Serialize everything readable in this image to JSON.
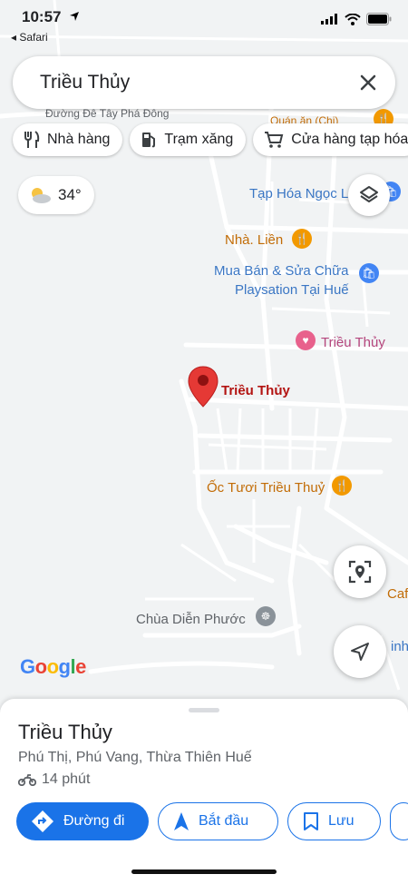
{
  "status_bar": {
    "time": "10:57",
    "back_app": "◂ Safari"
  },
  "search": {
    "query": "Triều Thủy"
  },
  "chips": [
    {
      "icon": "fork-knife-icon",
      "label": "Nhà hàng"
    },
    {
      "icon": "gas-pump-icon",
      "label": "Trạm xăng"
    },
    {
      "icon": "cart-icon",
      "label": "Cửa hàng tạp hóa"
    }
  ],
  "weather": {
    "temp": "34°"
  },
  "map": {
    "road_label": "Đường Đê Tây Phá Đông",
    "partial_top_label": "Quán ăn (Chi)",
    "pois": {
      "tap_hoa": "Tạp Hóa Ngọc L",
      "nha_lien": "Nhà. Liền",
      "mua_ban_1": "Mua Bán & Sửa Chữa",
      "mua_ban_2": "Playsation Tại Huế",
      "trieu_thuy_heart": "Triều Thủy",
      "trieu_thuy_pin": "Triều Thủy",
      "oc_tuoi": "Ốc Tươi Triều Thuỷ",
      "cafe": "Caf",
      "chua": "Chùa Diễn Phước",
      "right_edge": "inh"
    },
    "logo": "Google"
  },
  "sheet": {
    "title": "Triều Thủy",
    "address": "Phú Thị, Phú Vang, Thừa Thiên Huế",
    "travel_time": "14 phút",
    "actions": {
      "directions": "Đường đi",
      "start": "Bắt đầu",
      "save": "Lưu"
    }
  },
  "colors": {
    "accent": "#1a73e8",
    "pin_red": "#e53935",
    "poi_orange": "#f29900",
    "poi_blue": "#4285f4",
    "poi_pink": "#e8618c"
  }
}
